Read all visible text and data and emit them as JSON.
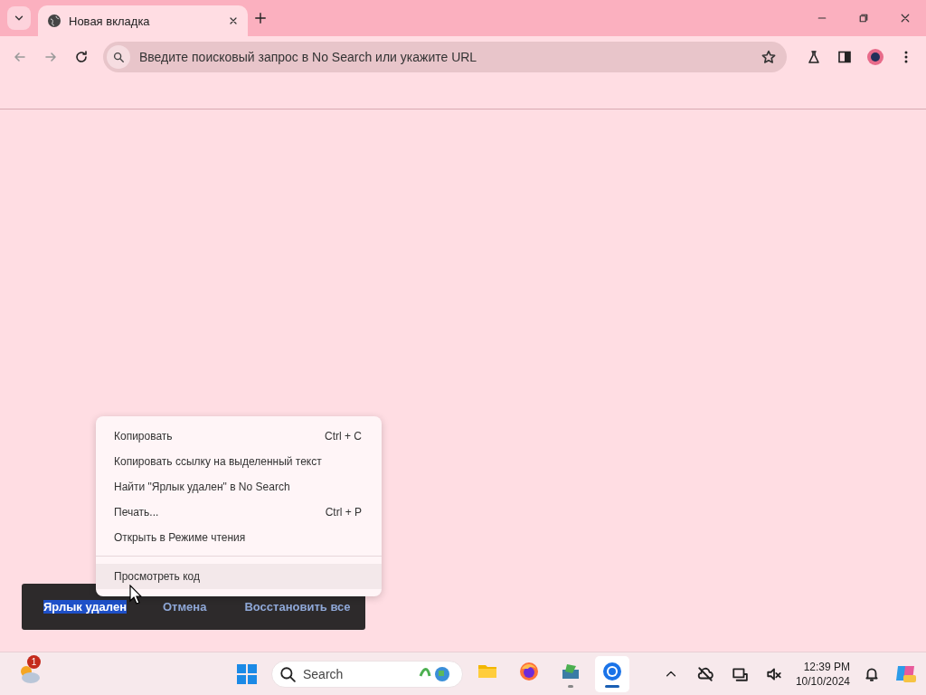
{
  "tabs": [
    {
      "title": "Новая вкладка",
      "selected": true
    }
  ],
  "address_bar": {
    "placeholder": "Введите поисковый запрос в No Search или укажите URL"
  },
  "context_menu": {
    "groups": [
      {
        "items": [
          {
            "label": "Копировать",
            "shortcut": "Ctrl + C",
            "selected": false
          },
          {
            "label": "Копировать ссылку на выделенный текст",
            "selected": false
          },
          {
            "label": "Найти \"Ярлык удален\" в No Search",
            "selected": false
          },
          {
            "label": "Печать...",
            "shortcut": "Ctrl + P",
            "selected": false
          },
          {
            "label": "Открыть в Режиме чтения",
            "selected": false
          }
        ]
      },
      {
        "items": [
          {
            "label": "Просмотреть код",
            "selected": true
          }
        ]
      }
    ]
  },
  "snackbar": {
    "message": "Ярлык удален",
    "message_highlighted": true,
    "actions": [
      "Отмена",
      "Восстановить все"
    ]
  },
  "taskbar": {
    "widget_badge": "1",
    "search": {
      "placeholder": "Search"
    },
    "apps": [
      {
        "kind": "files",
        "running": false,
        "active": false
      },
      {
        "kind": "firefox",
        "running": false,
        "active": false
      },
      {
        "kind": "installer",
        "running": true,
        "active": false
      },
      {
        "kind": "chrome",
        "running": true,
        "active": true
      }
    ],
    "time": "12:39 PM",
    "date": "10/10/2024"
  }
}
